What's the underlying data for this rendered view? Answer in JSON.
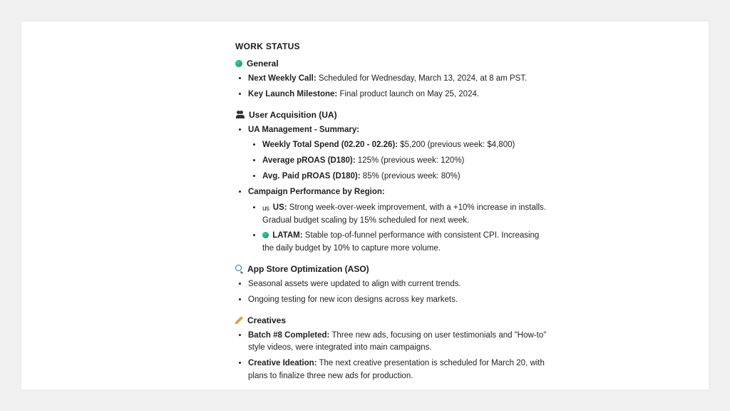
{
  "title": "WORK STATUS",
  "sections": {
    "general": {
      "label": "General",
      "items": [
        {
          "label": "Next Weekly Call:",
          "text": " Scheduled for Wednesday, March 13, 2024, at 8 am PST."
        },
        {
          "label": "Key Launch Milestone:",
          "text": " Final product launch on May 25, 2024."
        }
      ]
    },
    "ua": {
      "label": "User Acquisition (UA)",
      "summary_label": "UA Management - Summary:",
      "summary": [
        {
          "label": "Weekly Total Spend (02.20 - 02.26):",
          "text": " $5,200 (previous week: $4,800)"
        },
        {
          "label": "Average pROAS (D180):",
          "text": " 125% (previous week: 120%)"
        },
        {
          "label": "Avg. Paid pROAS (D180):",
          "text": " 85% (previous week: 80%)"
        }
      ],
      "region_label": "Campaign Performance by Region:",
      "regions": [
        {
          "prefix": "us",
          "label": "US:",
          "text": " Strong week-over-week improvement, with a +10% increase in installs. Gradual budget scaling by 15% scheduled for next week."
        },
        {
          "prefix_icon": "green",
          "label": "LATAM:",
          "text": " Stable top-of-funnel performance with consistent CPI. Increasing the daily budget by 10% to capture more volume."
        }
      ]
    },
    "aso": {
      "label": "App Store Optimization (ASO)",
      "items": [
        "Seasonal assets were updated to align with current trends.",
        "Ongoing testing for new icon designs across key markets."
      ]
    },
    "creatives": {
      "label": "Creatives",
      "items": [
        {
          "label": "Batch #8 Completed:",
          "text": " Three new ads, focusing on user testimonials and \"How-to\" style videos, were integrated into main campaigns."
        },
        {
          "label": "Creative Ideation:",
          "text": " The next creative presentation is scheduled for March 20, with plans to finalize three new ads for production."
        }
      ]
    }
  }
}
